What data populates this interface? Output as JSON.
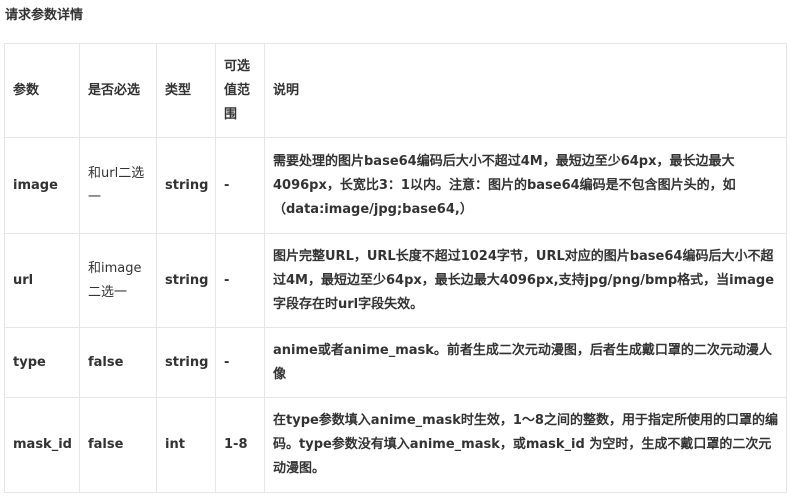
{
  "heading": "请求参数详情",
  "table": {
    "headers": {
      "name": "参数",
      "required": "是否必选",
      "type": "类型",
      "range": "可选值范围",
      "desc": "说明"
    },
    "rows": [
      {
        "name": "image",
        "required": "和url二选一",
        "type": "string",
        "range": "-",
        "desc": "需要处理的图片base64编码后大小不超过4M，最短边至少64px，最长边最大4096px，长宽比3：1以内。注意：图片的base64编码是不包含图片头的，如（data:image/jpg;base64,）"
      },
      {
        "name": "url",
        "required": "和image二选一",
        "type": "string",
        "range": "-",
        "desc": "图片完整URL，URL长度不超过1024字节，URL对应的图片base64编码后大小不超过4M，最短边至少64px，最长边最大4096px,支持jpg/png/bmp格式，当image字段存在时url字段失效。"
      },
      {
        "name": "type",
        "required": "false",
        "type": "string",
        "range": "-",
        "desc": "anime或者anime_mask。前者生成二次元动漫图，后者生成戴口罩的二次元动漫人像"
      },
      {
        "name": "mask_id",
        "required": "false",
        "type": "int",
        "range": "1-8",
        "desc": "在type参数填入anime_mask时生效，1～8之间的整数，用于指定所使用的口罩的编码。type参数没有填入anime_mask，或mask_id 为空时，生成不戴口罩的二次元动漫图。"
      }
    ]
  }
}
